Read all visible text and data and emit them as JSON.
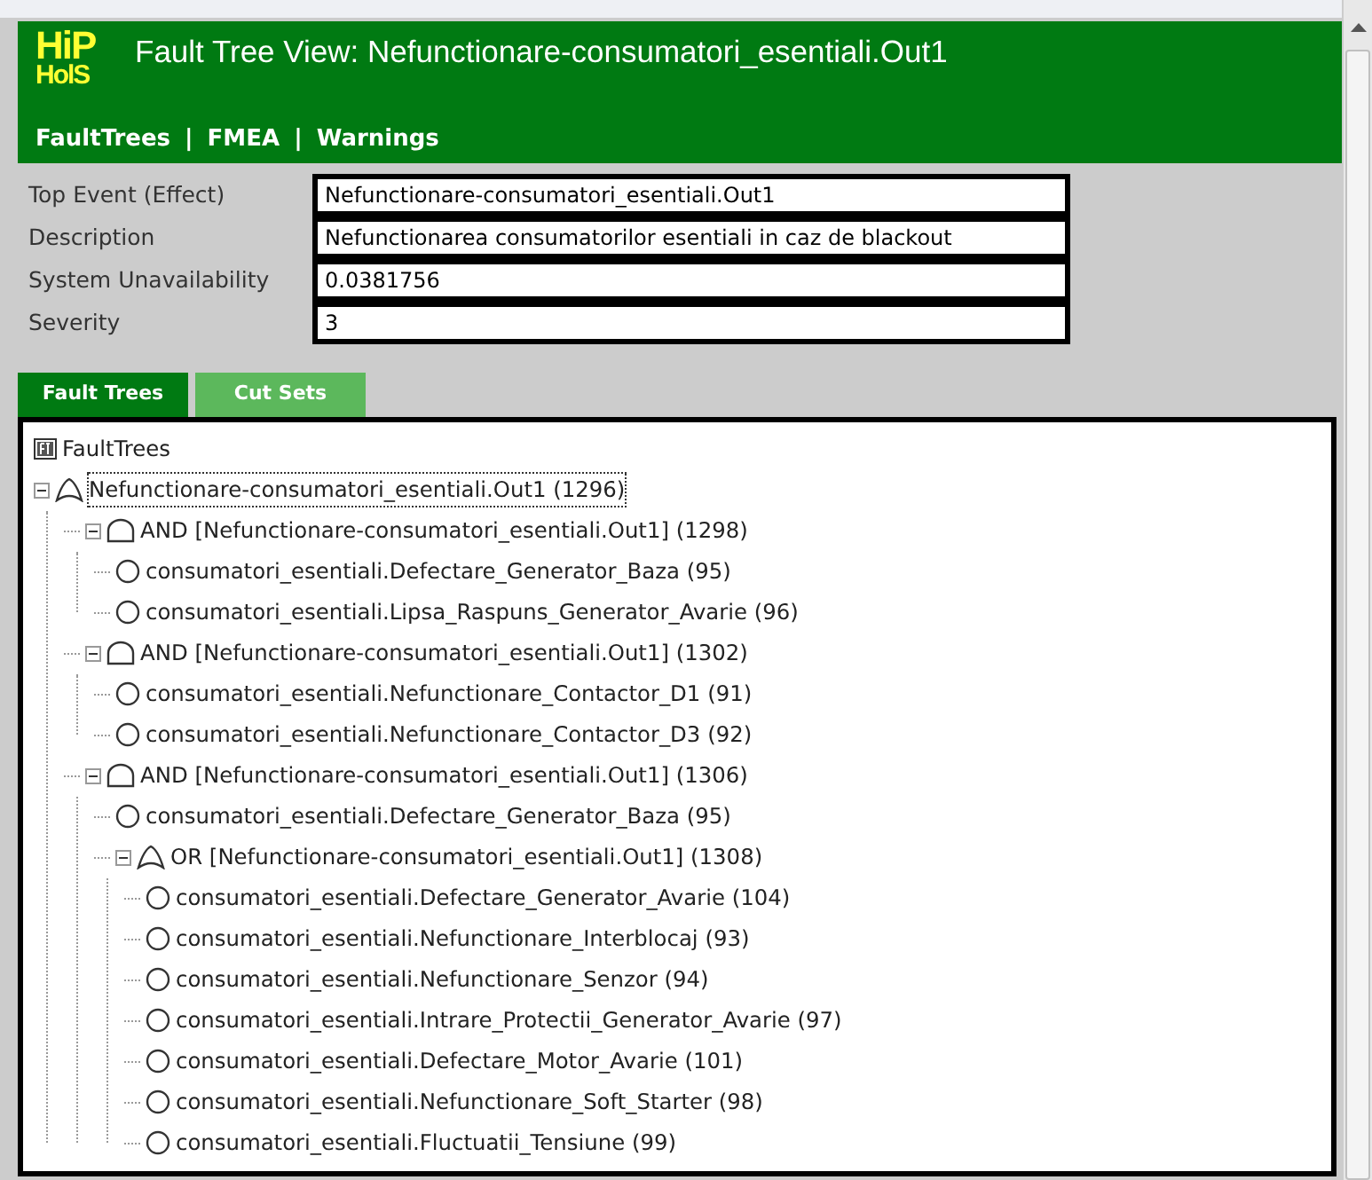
{
  "header": {
    "logo_lines": [
      "HiP",
      "HolS"
    ],
    "title": "Fault Tree View: Nefunctionare-consumatori_esentiali.Out1"
  },
  "nav": [
    "FaultTrees",
    "FMEA",
    "Warnings"
  ],
  "nav_separator": "|",
  "fields": [
    {
      "label": "Top Event (Effect)",
      "value": "Nefunctionare-consumatori_esentiali.Out1"
    },
    {
      "label": "Description",
      "value": "Nefunctionarea consumatorilor esentiali in caz de blackout"
    },
    {
      "label": "System Unavailability",
      "value": "0.0381756"
    },
    {
      "label": "Severity",
      "value": "3"
    }
  ],
  "tabs": [
    {
      "label": "Fault Trees",
      "selected": true
    },
    {
      "label": "Cut Sets",
      "selected": false
    }
  ],
  "tree": {
    "title": "FaultTrees",
    "nodes": [
      {
        "kind": "or",
        "label": "Nefunctionare-consumatori_esentiali.Out1 (1296)",
        "selected": true,
        "expanded": true,
        "children": [
          {
            "kind": "and",
            "label": "AND [Nefunctionare-consumatori_esentiali.Out1] (1298)",
            "selected": false,
            "expanded": true,
            "children": [
              {
                "kind": "basic",
                "label": "consumatori_esentiali.Defectare_Generator_Baza (95)",
                "selected": false
              },
              {
                "kind": "basic",
                "label": "consumatori_esentiali.Lipsa_Raspuns_Generator_Avarie (96)",
                "selected": false
              }
            ]
          },
          {
            "kind": "and",
            "label": "AND [Nefunctionare-consumatori_esentiali.Out1] (1302)",
            "selected": false,
            "expanded": true,
            "children": [
              {
                "kind": "basic",
                "label": "consumatori_esentiali.Nefunctionare_Contactor_D1 (91)",
                "selected": false
              },
              {
                "kind": "basic",
                "label": "consumatori_esentiali.Nefunctionare_Contactor_D3 (92)",
                "selected": false
              }
            ]
          },
          {
            "kind": "and",
            "label": "AND [Nefunctionare-consumatori_esentiali.Out1] (1306)",
            "selected": false,
            "expanded": true,
            "children": [
              {
                "kind": "basic",
                "label": "consumatori_esentiali.Defectare_Generator_Baza (95)",
                "selected": false
              },
              {
                "kind": "or",
                "label": "OR [Nefunctionare-consumatori_esentiali.Out1] (1308)",
                "selected": false,
                "expanded": true,
                "children": [
                  {
                    "kind": "basic",
                    "label": "consumatori_esentiali.Defectare_Generator_Avarie (104)",
                    "selected": false
                  },
                  {
                    "kind": "basic",
                    "label": "consumatori_esentiali.Nefunctionare_Interblocaj (93)",
                    "selected": false
                  },
                  {
                    "kind": "basic",
                    "label": "consumatori_esentiali.Nefunctionare_Senzor (94)",
                    "selected": false
                  },
                  {
                    "kind": "basic",
                    "label": "consumatori_esentiali.Intrare_Protectii_Generator_Avarie (97)",
                    "selected": false
                  },
                  {
                    "kind": "basic",
                    "label": "consumatori_esentiali.Defectare_Motor_Avarie (101)",
                    "selected": false
                  },
                  {
                    "kind": "basic",
                    "label": "consumatori_esentiali.Nefunctionare_Soft_Starter (98)",
                    "selected": false
                  },
                  {
                    "kind": "basic",
                    "label": "consumatori_esentiali.Fluctuatii_Tensiune (99)",
                    "selected": false
                  }
                ]
              }
            ]
          }
        ]
      }
    ]
  }
}
